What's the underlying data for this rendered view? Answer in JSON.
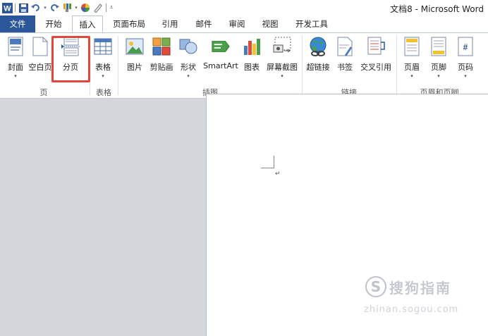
{
  "window": {
    "title": "文档8 - Microsoft Word"
  },
  "qat": {
    "word_icon": "word-app-icon",
    "save": "save-icon",
    "undo": "undo-icon",
    "redo": "redo-icon",
    "format": "format-painter-icon",
    "color": "color-icon",
    "customize": "customize-qat-icon"
  },
  "tabs": [
    {
      "label": "文件"
    },
    {
      "label": "开始"
    },
    {
      "label": "插入"
    },
    {
      "label": "页面布局"
    },
    {
      "label": "引用"
    },
    {
      "label": "邮件"
    },
    {
      "label": "审阅"
    },
    {
      "label": "视图"
    },
    {
      "label": "开发工具"
    }
  ],
  "ribbon": {
    "buttons": [
      {
        "label": "封面",
        "icon": "cover-page-icon"
      },
      {
        "label": "空白页",
        "icon": "blank-page-icon"
      },
      {
        "label": "分页",
        "icon": "page-break-icon"
      },
      {
        "label": "表格",
        "icon": "table-icon"
      },
      {
        "label": "图片",
        "icon": "picture-icon"
      },
      {
        "label": "剪贴画",
        "icon": "clip-art-icon"
      },
      {
        "label": "形状",
        "icon": "shapes-icon"
      },
      {
        "label": "SmartArt",
        "icon": "smartart-icon"
      },
      {
        "label": "图表",
        "icon": "chart-icon"
      },
      {
        "label": "屏幕截图",
        "icon": "screenshot-icon"
      },
      {
        "label": "超链接",
        "icon": "hyperlink-icon"
      },
      {
        "label": "书签",
        "icon": "bookmark-icon"
      },
      {
        "label": "交叉引用",
        "icon": "cross-reference-icon"
      },
      {
        "label": "页眉",
        "icon": "header-icon"
      },
      {
        "label": "页脚",
        "icon": "footer-icon"
      },
      {
        "label": "页码",
        "icon": "page-number-icon"
      }
    ],
    "groups": [
      {
        "label": "页"
      },
      {
        "label": "表格"
      },
      {
        "label": "插图"
      },
      {
        "label": "链接"
      },
      {
        "label": "页眉和页脚"
      }
    ],
    "highlight_color": "#e2453c"
  },
  "document": {
    "paragraph_mark": "↵"
  },
  "watermark": {
    "logo": "S",
    "text": "搜狗指南",
    "url": "zhinan.sogou.com"
  },
  "colors": {
    "file_tab": "#2b579a",
    "workspace": "#d3d6db",
    "page": "#ffffff"
  }
}
